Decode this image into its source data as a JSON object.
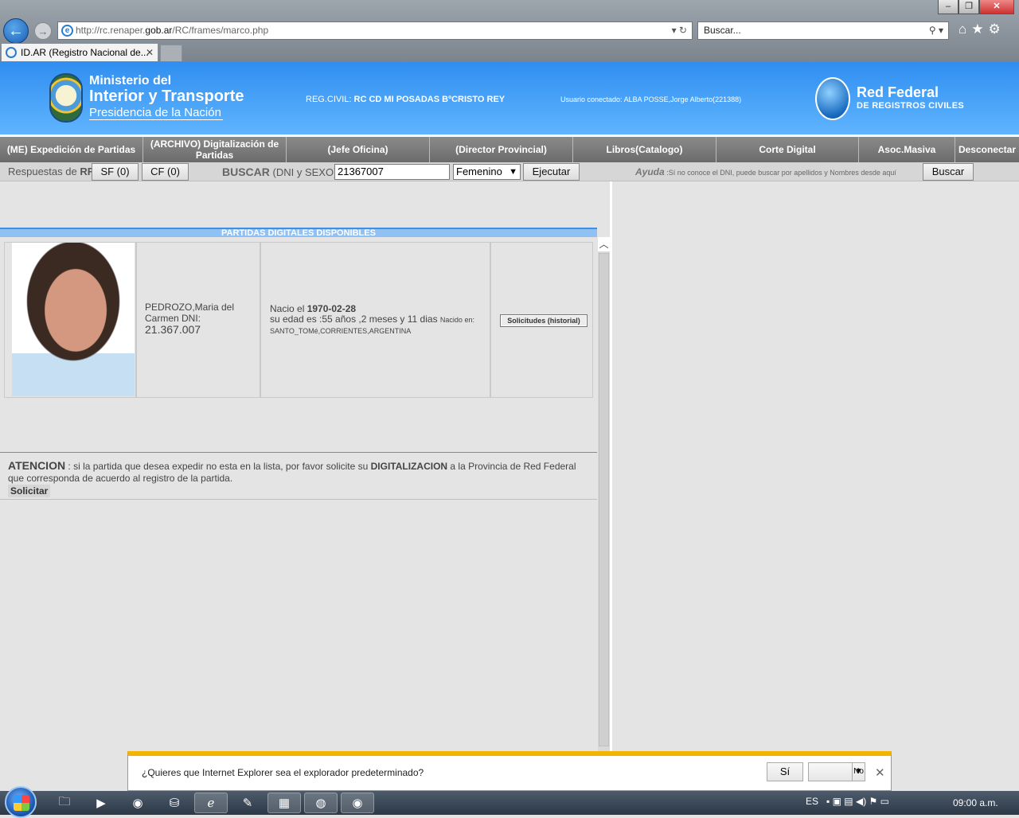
{
  "browser": {
    "url_prefix": "http://rc.renaper.",
    "url_domain": "gob.ar",
    "url_path": "/RC/frames/marco.php",
    "search_placeholder": "Buscar...",
    "tab_title": "ID.AR (Registro Nacional de...",
    "icons": [
      "back-icon",
      "forward-icon",
      "ie-icon",
      "refresh-icon",
      "search-icon",
      "home-icon",
      "star-icon",
      "gear-icon",
      "close-icon"
    ]
  },
  "banner": {
    "ministry_line1": "Ministerio del",
    "ministry_line2": "Interior y Transporte",
    "ministry_line3": "Presidencia de la Nación",
    "reg_civil_label": "REG.CIVIL: ",
    "reg_civil_value": "RC CD MI POSADAS BºCRISTO REY",
    "user_label": "Usuario conectado: ",
    "user_value": "ALBA POSSE,Jorge Alberto(221388)",
    "rf_title": "Red Federal",
    "rf_subtitle": "DE REGISTROS CIVILES"
  },
  "menu": [
    {
      "label": "(ME) Expedición de Partidas"
    },
    {
      "label": "(ARCHIVO) Digitalización de Partidas"
    },
    {
      "label": "(Jefe Oficina)"
    },
    {
      "label": "(Director Provincial)"
    },
    {
      "label": "Libros(Catalogo)"
    },
    {
      "label": "Corte Digital"
    },
    {
      "label": "Asoc.Masiva"
    },
    {
      "label": "Desconectar"
    }
  ],
  "searchbar": {
    "respuestas": "Respuestas de ",
    "rf": "RF",
    "sf_button": "SF (0)",
    "cf_button": "CF (0)",
    "buscar": "BUSCAR",
    "buscar_hint": " (DNI y SEXO)",
    "dni_value": "21367007",
    "sex_selected": "Femenino",
    "ejecutar": "Ejecutar",
    "ayuda": "Ayuda",
    "ayuda_text": " :Sí no conoce el DNI, puede buscar por apellidos y Nombres desde aquí",
    "buscar_button": "Buscar"
  },
  "results": {
    "section_title": "PARTIDAS DIGITALES DISPONIBLES",
    "name": "PEDROZO,Maria del Carmen DNI:",
    "dni": "21.367.007",
    "nacio_label": "Nacio el ",
    "birth_date": "1970-02-28",
    "age_text": "su edad es :55 años ,2 meses y 11 dias ",
    "nacido_label": "Nacido en:",
    "birthplace": "SANTO_TOMé,CORRIENTES,ARGENTINA",
    "solicitudes_button": "Solicitudes (historial)"
  },
  "attention": {
    "title": "ATENCION",
    "text1": " : si la partida que desea expedir no esta en la lista, por favor solicite su ",
    "digitalizacion": "DIGITALIZACION",
    "text2": " a la Provincia de Red Federal que corresponda de acuerdo al registro de la partida.",
    "button": "Solicitar"
  },
  "notification": {
    "question": "¿Quieres que Internet Explorer sea el explorador predeterminado?",
    "yes": "Sí",
    "no": "No"
  },
  "taskbar": {
    "lang": "ES",
    "clock": "09:00 a.m."
  }
}
